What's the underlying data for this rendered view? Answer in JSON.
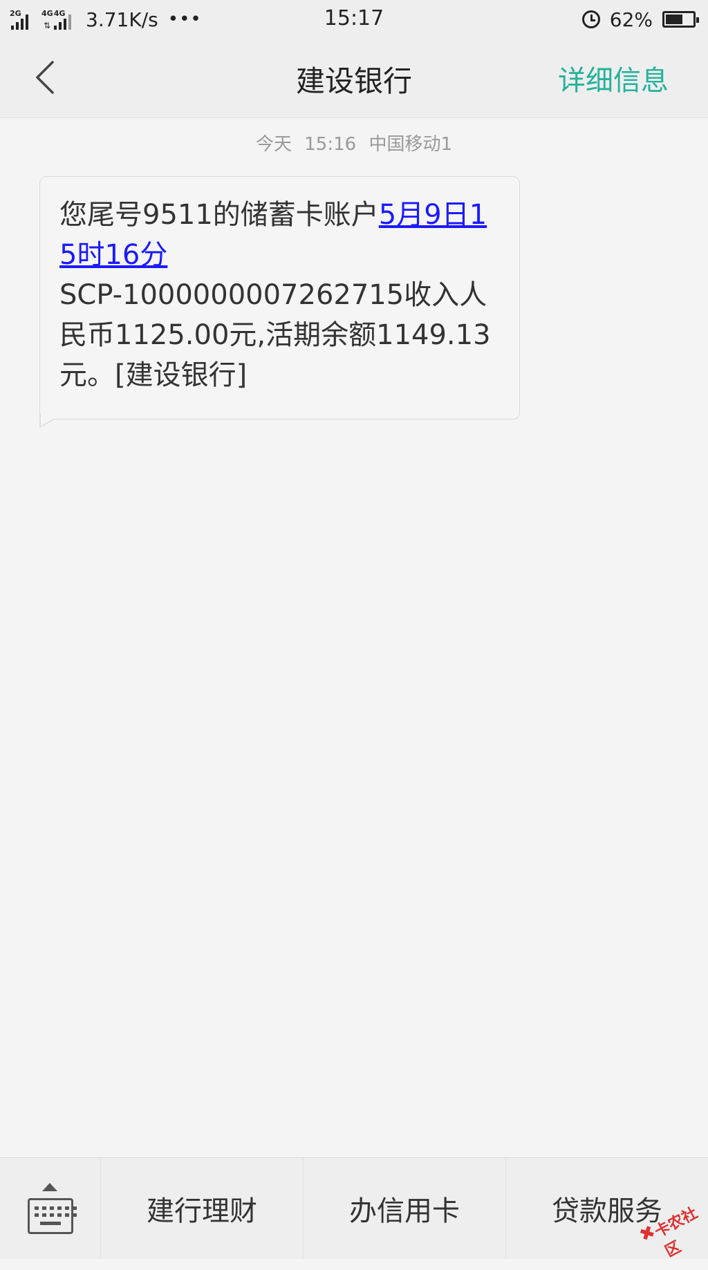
{
  "status_bar": {
    "net1_label": "2G",
    "net2_label": "4G",
    "net2b_label": "4G",
    "net_speed": "3.71K/s",
    "more_dots": "•••",
    "time": "15:17",
    "battery_percent": "62%",
    "battery_level": 0.62
  },
  "header": {
    "title": "建设银行",
    "details_label": "详细信息"
  },
  "conversation": {
    "meta_day": "今天",
    "meta_time": "15:16",
    "meta_carrier": "中国移动1",
    "message": {
      "part1": "您尾号9511的储蓄卡账户",
      "link": "5月9日15时16分",
      "part2": "SCP-1000000007262715收入人民币1125.00元,活期余额1149.13元。[建设银行]"
    }
  },
  "bottom_bar": {
    "items": [
      {
        "label": "建行理财"
      },
      {
        "label": "办信用卡"
      },
      {
        "label": "贷款服务"
      }
    ]
  },
  "watermark": {
    "text": "卡农社区"
  }
}
